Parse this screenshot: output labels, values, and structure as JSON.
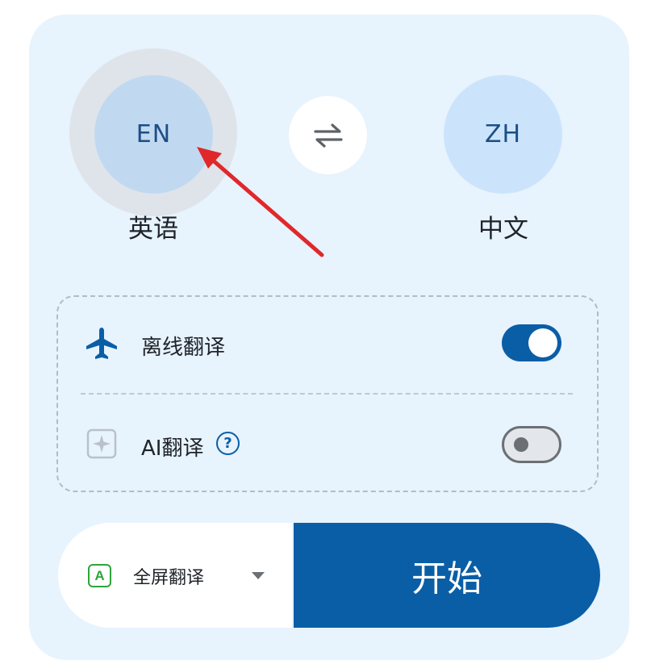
{
  "source_language": {
    "code": "EN",
    "name": "英语"
  },
  "target_language": {
    "code": "ZH",
    "name": "中文"
  },
  "swap": {
    "icon": "swap-arrows-icon"
  },
  "options": [
    {
      "label": "离线翻译",
      "icon": "airplane-icon",
      "enabled": true
    },
    {
      "label": "AI翻译",
      "icon": "sparkle-icon",
      "enabled": false,
      "help": "?"
    }
  ],
  "mode": {
    "icon_letter": "A",
    "label": "全屏翻译"
  },
  "start_label": "开始",
  "colors": {
    "accent": "#0a5ea6",
    "panel": "#e7f3fd",
    "mode_icon": "#2da53b",
    "annotation_arrow": "#e0282b"
  }
}
